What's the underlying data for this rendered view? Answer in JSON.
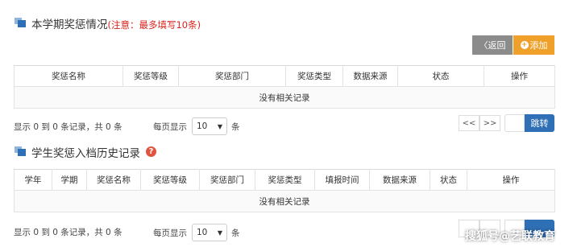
{
  "section1": {
    "title": "本学期奖惩情况",
    "note": "(注意：最多填写10条)",
    "back_button": "〈返回",
    "add_button": "添加",
    "columns": [
      "奖惩名称",
      "奖惩等级",
      "奖惩部门",
      "奖惩类型",
      "数据来源",
      "状态",
      "操作"
    ],
    "empty_text": "没有相关记录",
    "footer_text": "显示 0 到 0 条记录，共 0 条",
    "per_page_label": "每页显示",
    "per_page_value": "10",
    "per_page_unit": "条",
    "prev_label": "<<",
    "next_label": ">>",
    "jump_label": "跳转"
  },
  "section2": {
    "title": "学生奖惩入档历史记录",
    "columns": [
      "学年",
      "学期",
      "奖惩名称",
      "奖惩等级",
      "奖惩部门",
      "奖惩类型",
      "填报时间",
      "数据来源",
      "状态",
      "操作"
    ],
    "empty_text": "没有相关记录",
    "footer_text": "显示 0 到 0 条记录，共 0 条",
    "per_page_label": "每页显示",
    "per_page_value": "10",
    "per_page_unit": "条"
  },
  "watermark": "搜狐号@艺联教育",
  "colors": {
    "accent_blue": "#2f6fb5",
    "add_orange": "#efa02a",
    "back_gray": "#8b8b8b",
    "note_red": "#d9241c"
  }
}
